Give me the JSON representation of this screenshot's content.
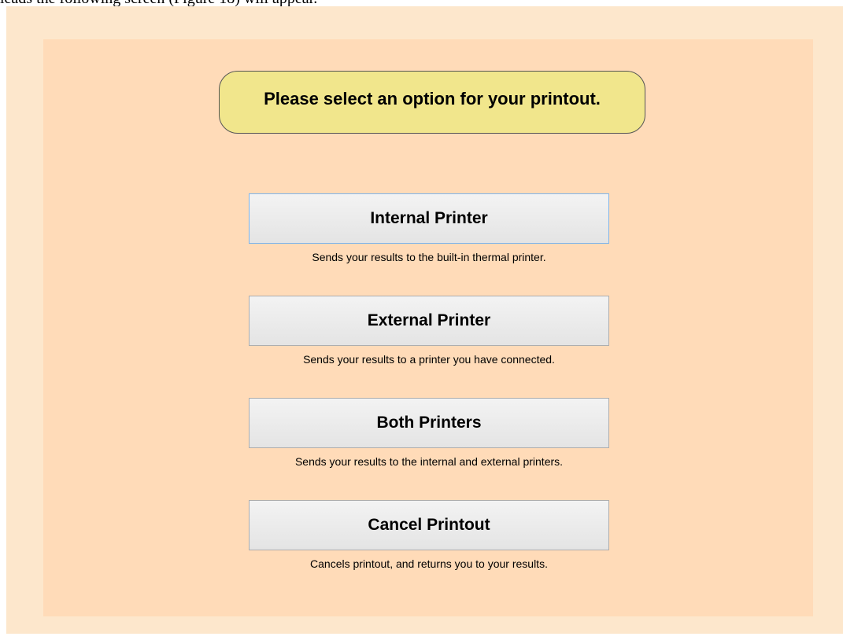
{
  "document": {
    "caption": "leads the following screen (Figure 18) will appear."
  },
  "prompt": {
    "text": "Please select an option for your printout."
  },
  "options": [
    {
      "label": "Internal Printer",
      "description": "Sends your results to the built-in thermal printer."
    },
    {
      "label": "External Printer",
      "description": "Sends your results to a printer you have connected."
    },
    {
      "label": "Both Printers",
      "description": "Sends your results to the internal and external printers."
    },
    {
      "label": "Cancel Printout",
      "description": "Cancels printout, and returns you to your results."
    }
  ],
  "colors": {
    "outer_frame": "#FDE7CC",
    "inner_panel": "#FFDBB8",
    "prompt_fill": "#F1E68C",
    "button_fill": "#F0F0F0",
    "focus_border": "#7EB4EA"
  }
}
